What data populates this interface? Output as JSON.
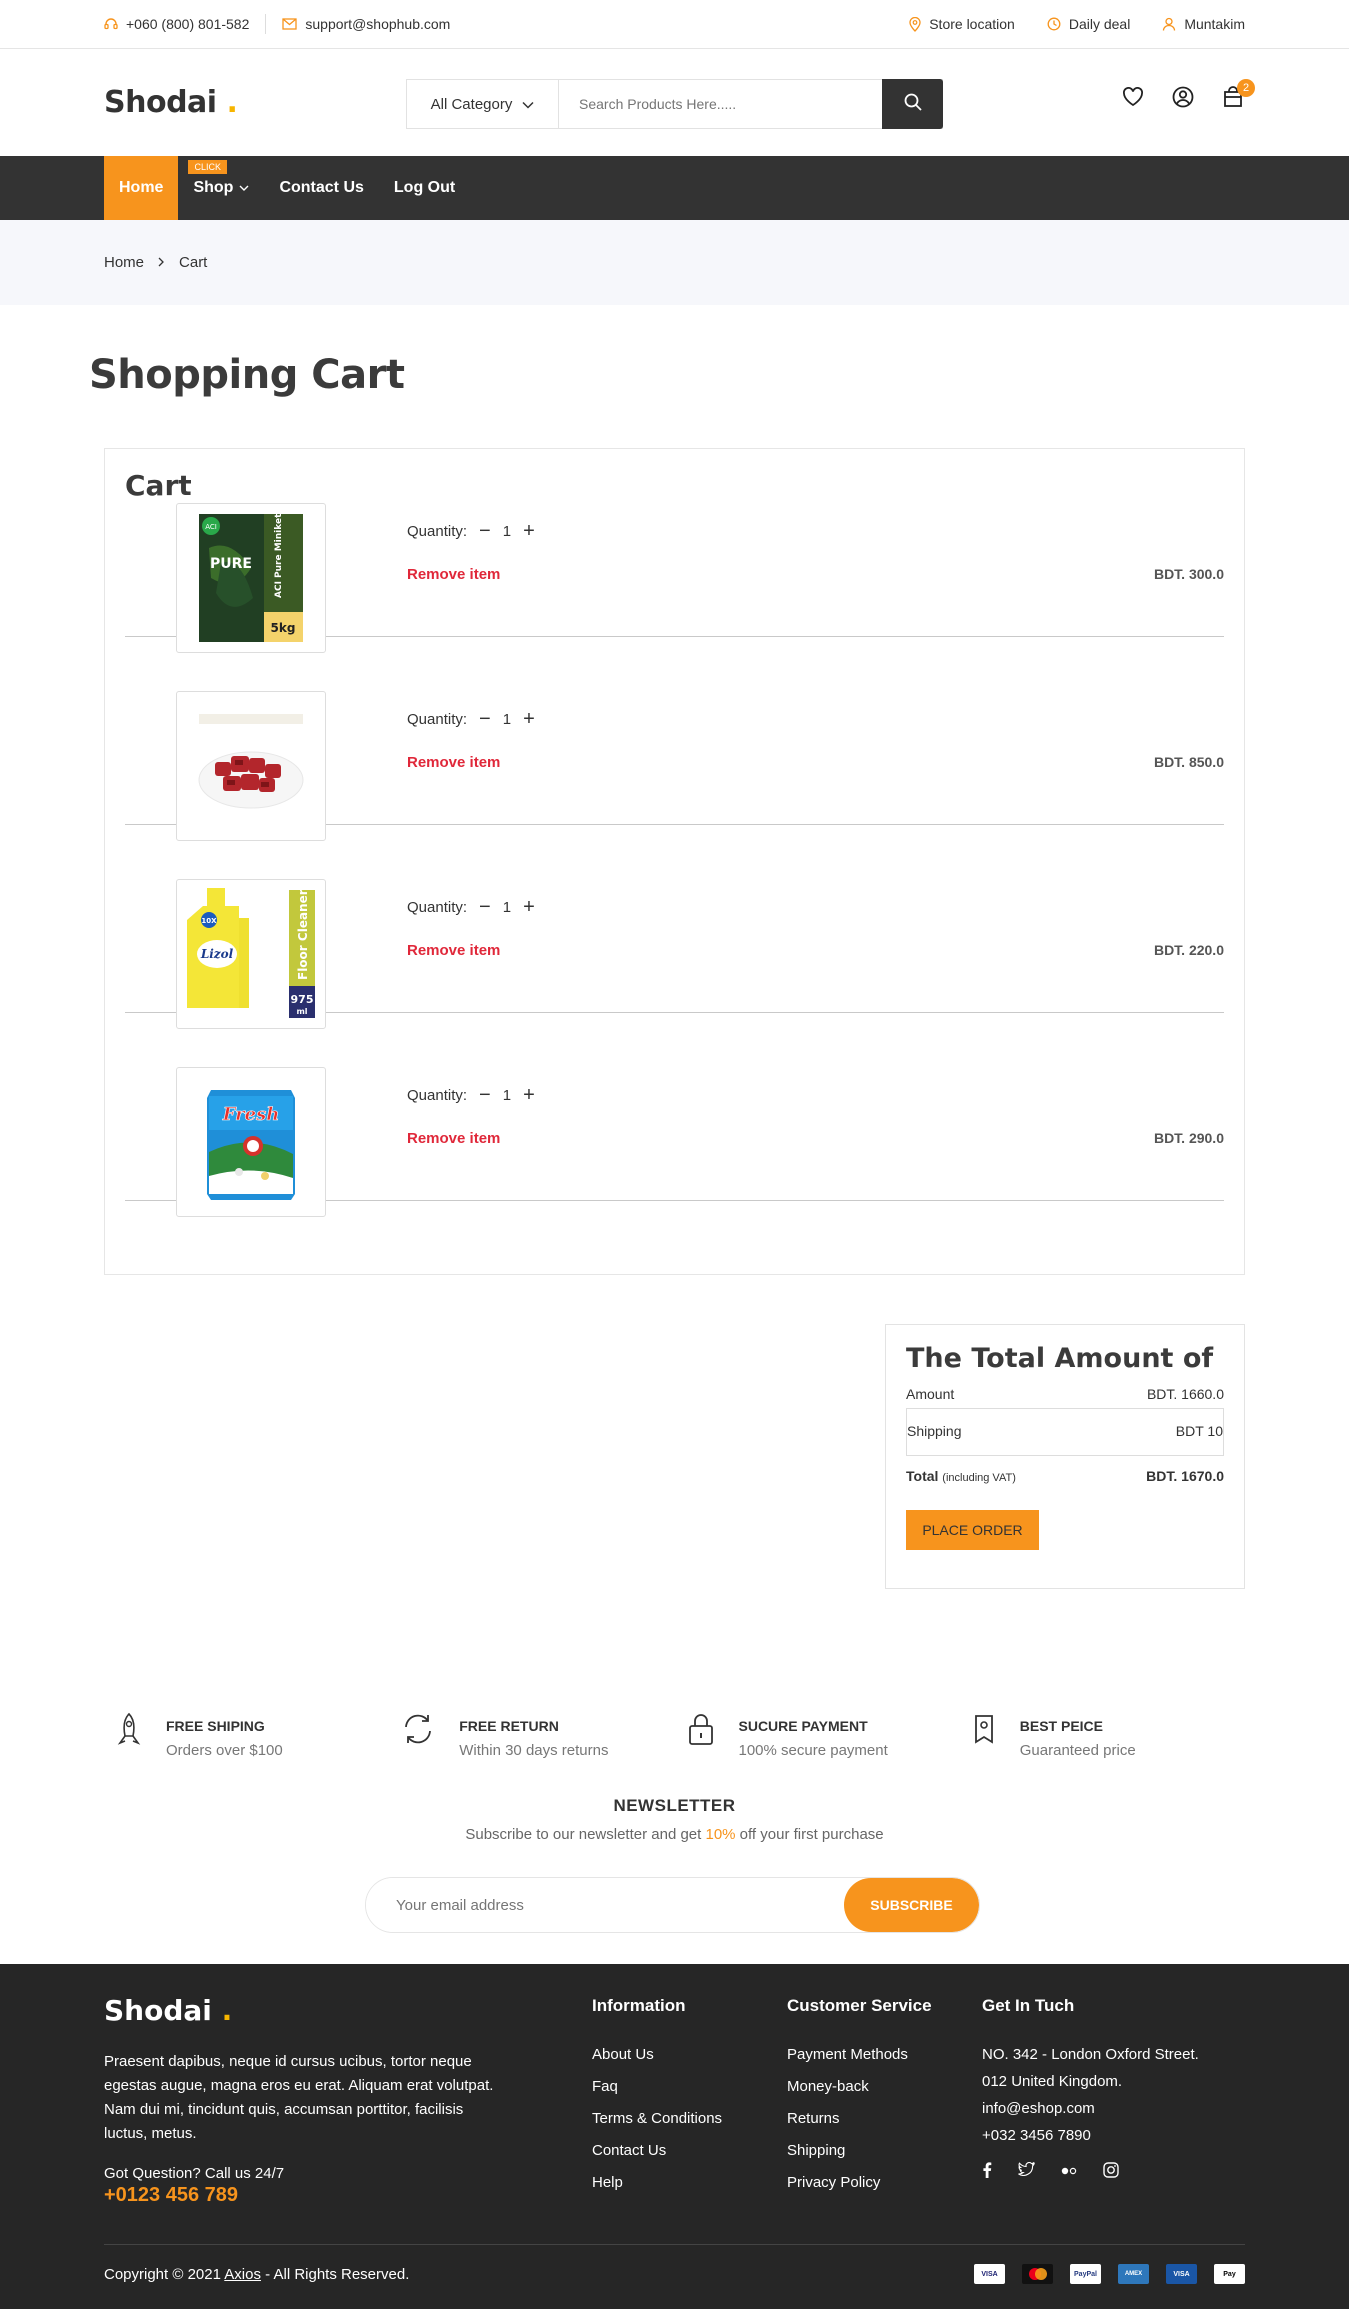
{
  "topbar": {
    "phone": "+060 (800) 801-582",
    "email": "support@shophub.com",
    "store_location": "Store location",
    "daily_deal": "Daily deal",
    "user": "Muntakim"
  },
  "header": {
    "logo": "Shodai",
    "logo_dot": ".",
    "category_select": "All Category",
    "search_placeholder": "Search Products Here.....",
    "cart_count": "2"
  },
  "nav": {
    "items": [
      "Home",
      "Shop",
      "Contact Us",
      "Log Out"
    ],
    "shop_badge": "CLICK"
  },
  "breadcrumb": [
    "Home",
    "Cart"
  ],
  "page_title": "Shopping Cart",
  "cart": {
    "heading": "Cart",
    "quantity_label": "Quantity:",
    "remove_label": "Remove item",
    "items": [
      {
        "name": "ACI Pure Miniket Rice 5kg",
        "pack_text": "ACI Pure Miniket Rice",
        "weight": "5kg",
        "qty": "1",
        "price": "BDT. 300.0"
      },
      {
        "name": "Beef Cubes",
        "qty": "1",
        "price": "BDT. 850.0"
      },
      {
        "name": "Lizol Floor Cleaner 975ml",
        "pack_text": "Floor Cleaner",
        "volume": "975",
        "volume_unit": "ml",
        "qty": "1",
        "price": "BDT. 220.0"
      },
      {
        "name": "Fresh Milk Powder",
        "brand": "Fresh",
        "qty": "1",
        "price": "BDT. 290.0"
      }
    ]
  },
  "totals": {
    "heading": "The Total Amount of",
    "amount_label": "Amount",
    "amount_value": "BDT. 1660.0",
    "shipping_label": "Shipping",
    "shipping_value": "BDT 10",
    "total_label": "Total",
    "total_note": "(including VAT)",
    "total_value": "BDT. 1670.0",
    "button": "PLACE ORDER"
  },
  "features": [
    {
      "title": "FREE SHIPING",
      "desc": "Orders over $100",
      "icon": "rocket-icon"
    },
    {
      "title": "FREE RETURN",
      "desc": "Within 30 days returns",
      "icon": "refresh-icon"
    },
    {
      "title": "SUCURE PAYMENT",
      "desc": "100% secure payment",
      "icon": "lock-icon"
    },
    {
      "title": "BEST PEICE",
      "desc": "Guaranteed price",
      "icon": "tag-icon"
    }
  ],
  "newsletter": {
    "title": "NEWSLETTER",
    "text_before": "Subscribe to our newsletter and get ",
    "highlight": "10%",
    "text_after": " off your first purchase",
    "placeholder": "Your email address",
    "button": "SUBSCRIBE"
  },
  "footer": {
    "logo": "Shodai",
    "logo_dot": ".",
    "about": "Praesent dapibus, neque id cursus ucibus, tortor neque egestas augue, magna eros eu erat. Aliquam erat volutpat. Nam dui mi, tincidunt quis, accumsan porttitor, facilisis luctus, metus.",
    "question": "Got Question? Call us 24/7",
    "phone": "+0123 456 789",
    "info_title": "Information",
    "info_links": [
      "About Us",
      "Faq",
      "Terms & Conditions",
      "Contact Us",
      "Help"
    ],
    "service_title": "Customer Service",
    "service_links": [
      "Payment Methods",
      "Money-back",
      "Returns",
      "Shipping",
      "Privacy Policy"
    ],
    "contact_title": "Get In Tuch",
    "contact_lines": [
      "NO. 342 - London Oxford Street.",
      "012 United Kingdom.",
      "info@eshop.com",
      "+032 3456 7890"
    ],
    "copyright_before": "Copyright © 2021 ",
    "copyright_link": "Axios",
    "copyright_after": " - All Rights Reserved.",
    "payment_cards": [
      "VISA",
      "MC",
      "PayPal",
      "AMEX",
      "VISA",
      "Pay"
    ]
  },
  "colors": {
    "accent": "#f7941d",
    "dark": "#333333",
    "remove": "#e0283a",
    "footer_bg": "#262626"
  }
}
